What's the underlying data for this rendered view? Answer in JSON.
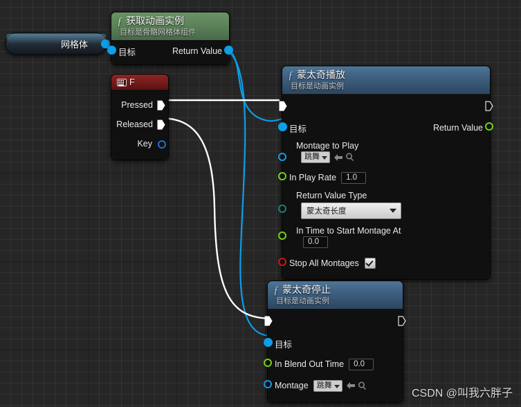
{
  "editor": {
    "name": "unreal-blueprint-graph",
    "background_color": "#262626",
    "grid_color": "#333333"
  },
  "watermark": {
    "text": "CSDN @叫我六胖子"
  },
  "nodes": {
    "mesh_variable": {
      "label": "网格体",
      "output_pin": {
        "name": "网格体",
        "type": "object",
        "color": "#0d9ee8"
      }
    },
    "get_anim_instance": {
      "title": "获取动画实例",
      "subtitle": "目标是骨骼网格体组件",
      "icon": "function-f-icon",
      "accent": "#5d8359",
      "inputs": [
        {
          "label": "目标",
          "type": "object",
          "color": "#0d9ee8"
        }
      ],
      "outputs": [
        {
          "label": "Return Value",
          "type": "object",
          "color": "#0d9ee8"
        }
      ]
    },
    "input_key_f": {
      "title": "F",
      "icon": "keyboard-icon",
      "accent": "#7a1c1c",
      "outputs": [
        {
          "label": "Pressed",
          "type": "exec"
        },
        {
          "label": "Released",
          "type": "exec"
        },
        {
          "label": "Key",
          "type": "struct",
          "color": "#1f6fd4"
        }
      ]
    },
    "montage_play": {
      "title": "蒙太奇播放",
      "subtitle": "目标是动画实例",
      "icon": "function-f-icon",
      "accent": "#3f6080",
      "exec_in": "",
      "exec_out": "",
      "inputs": [
        {
          "label": "目标",
          "type": "object",
          "color": "#0d9ee8"
        },
        {
          "label": "Montage to Play",
          "type": "object",
          "color": "#0d9ee8",
          "value": "跳舞",
          "widget": "asset-picker"
        },
        {
          "label": "In Play Rate",
          "type": "float",
          "color": "#73d216",
          "value": "1.0",
          "widget": "numeric"
        },
        {
          "label": "Return Value Type",
          "type": "enum",
          "color": "#17807a",
          "value": "蒙太奇长度",
          "widget": "dropdown"
        },
        {
          "label": "In Time to Start Montage At",
          "type": "float",
          "color": "#73d216",
          "value": "0.0",
          "widget": "numeric"
        },
        {
          "label": "Stop All Montages",
          "type": "bool",
          "color": "#cc1414",
          "value": true,
          "widget": "checkbox"
        }
      ],
      "outputs": [
        {
          "label": "Return Value",
          "type": "float",
          "color": "#73d216"
        }
      ]
    },
    "montage_stop": {
      "title": "蒙太奇停止",
      "subtitle": "目标是动画实例",
      "icon": "function-f-icon",
      "accent": "#3f6080",
      "inputs": [
        {
          "label": "目标",
          "type": "object",
          "color": "#0d9ee8"
        },
        {
          "label": "In Blend Out Time",
          "type": "float",
          "color": "#73d216",
          "value": "0.0",
          "widget": "numeric"
        },
        {
          "label": "Montage",
          "type": "object",
          "color": "#0d9ee8",
          "value": "跳舞",
          "widget": "asset-picker"
        }
      ],
      "outputs": []
    }
  },
  "connections": [
    {
      "from": "mesh_variable.out",
      "to": "get_anim_instance.目标",
      "color": "#0d9ee8"
    },
    {
      "from": "get_anim_instance.ReturnValue",
      "to": "montage_play.目标",
      "color": "#0d9ee8"
    },
    {
      "from": "get_anim_instance.ReturnValue",
      "to": "montage_stop.目标",
      "color": "#0d9ee8"
    },
    {
      "from": "input_key_f.Pressed",
      "to": "montage_play.exec",
      "color": "#ffffff"
    },
    {
      "from": "input_key_f.Released",
      "to": "montage_stop.exec",
      "color": "#ffffff"
    }
  ]
}
